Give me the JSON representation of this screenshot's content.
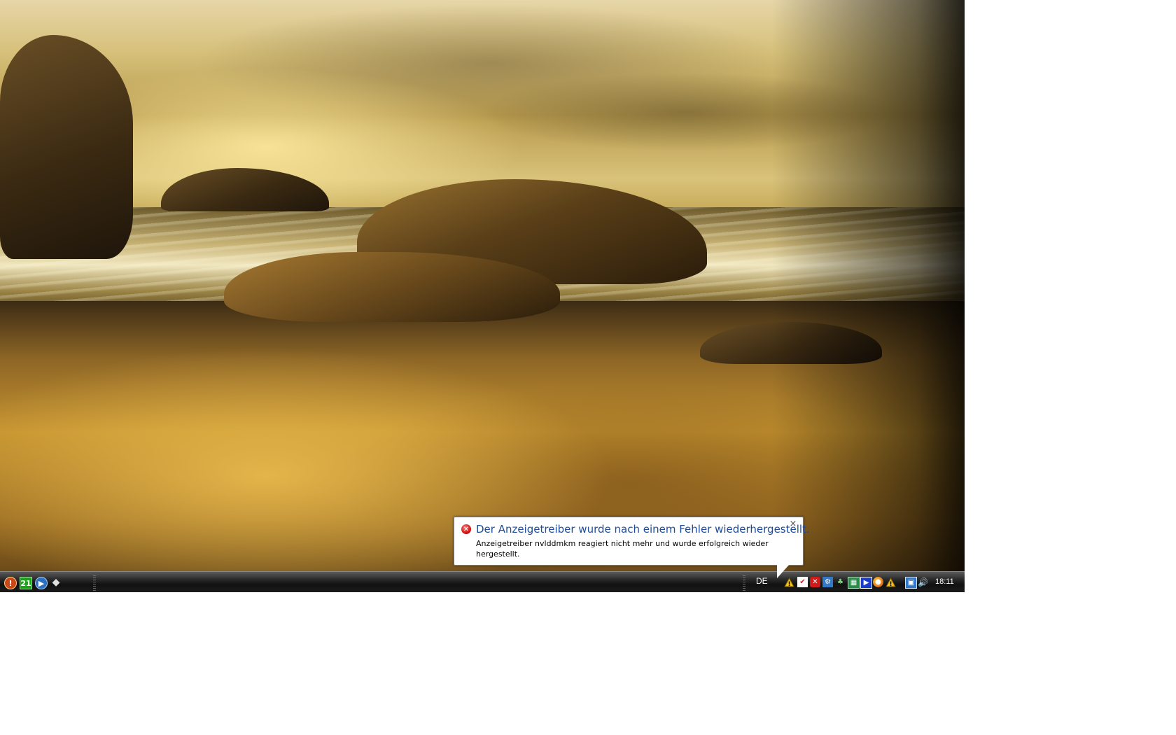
{
  "quick_launch": [
    {
      "icon": "info-shield-icon",
      "color": "#c8481b"
    },
    {
      "icon": "calendar-icon",
      "color": "#1aa31a",
      "label": "21"
    },
    {
      "icon": "media-player-icon",
      "color": "#2a6fc0"
    },
    {
      "icon": "diamond-icon",
      "color": "#d8d8d8"
    }
  ],
  "tray": {
    "language": "DE",
    "clock": "18:11",
    "icons": [
      {
        "icon": "warning-icon",
        "color": "#f1c21b"
      },
      {
        "icon": "red-check-icon",
        "color": "#cc1e1e"
      },
      {
        "icon": "red-x-icon",
        "color": "#d11a1a"
      },
      {
        "icon": "network-tool-icon",
        "color": "#3478c8"
      },
      {
        "icon": "usb-icon",
        "color": "#5aa35a"
      },
      {
        "icon": "monitor-icon",
        "color": "#2a8a4a"
      },
      {
        "icon": "play-icon",
        "color": "#1a3ec8"
      },
      {
        "icon": "firefox-icon",
        "color": "#e47a1a"
      },
      {
        "icon": "warning-icon",
        "color": "#f1c21b"
      },
      {
        "icon": "network-icon",
        "color": "#3478c8"
      },
      {
        "icon": "volume-icon",
        "color": "#cfcfcf"
      }
    ]
  },
  "notification": {
    "title": "Der Anzeigetreiber wurde nach einem Fehler wiederhergestellt.",
    "message": "Anzeigetreiber nvlddmkm reagiert nicht mehr und wurde erfolgreich wieder hergestellt.",
    "close_glyph": "×",
    "icon": "error-icon"
  }
}
